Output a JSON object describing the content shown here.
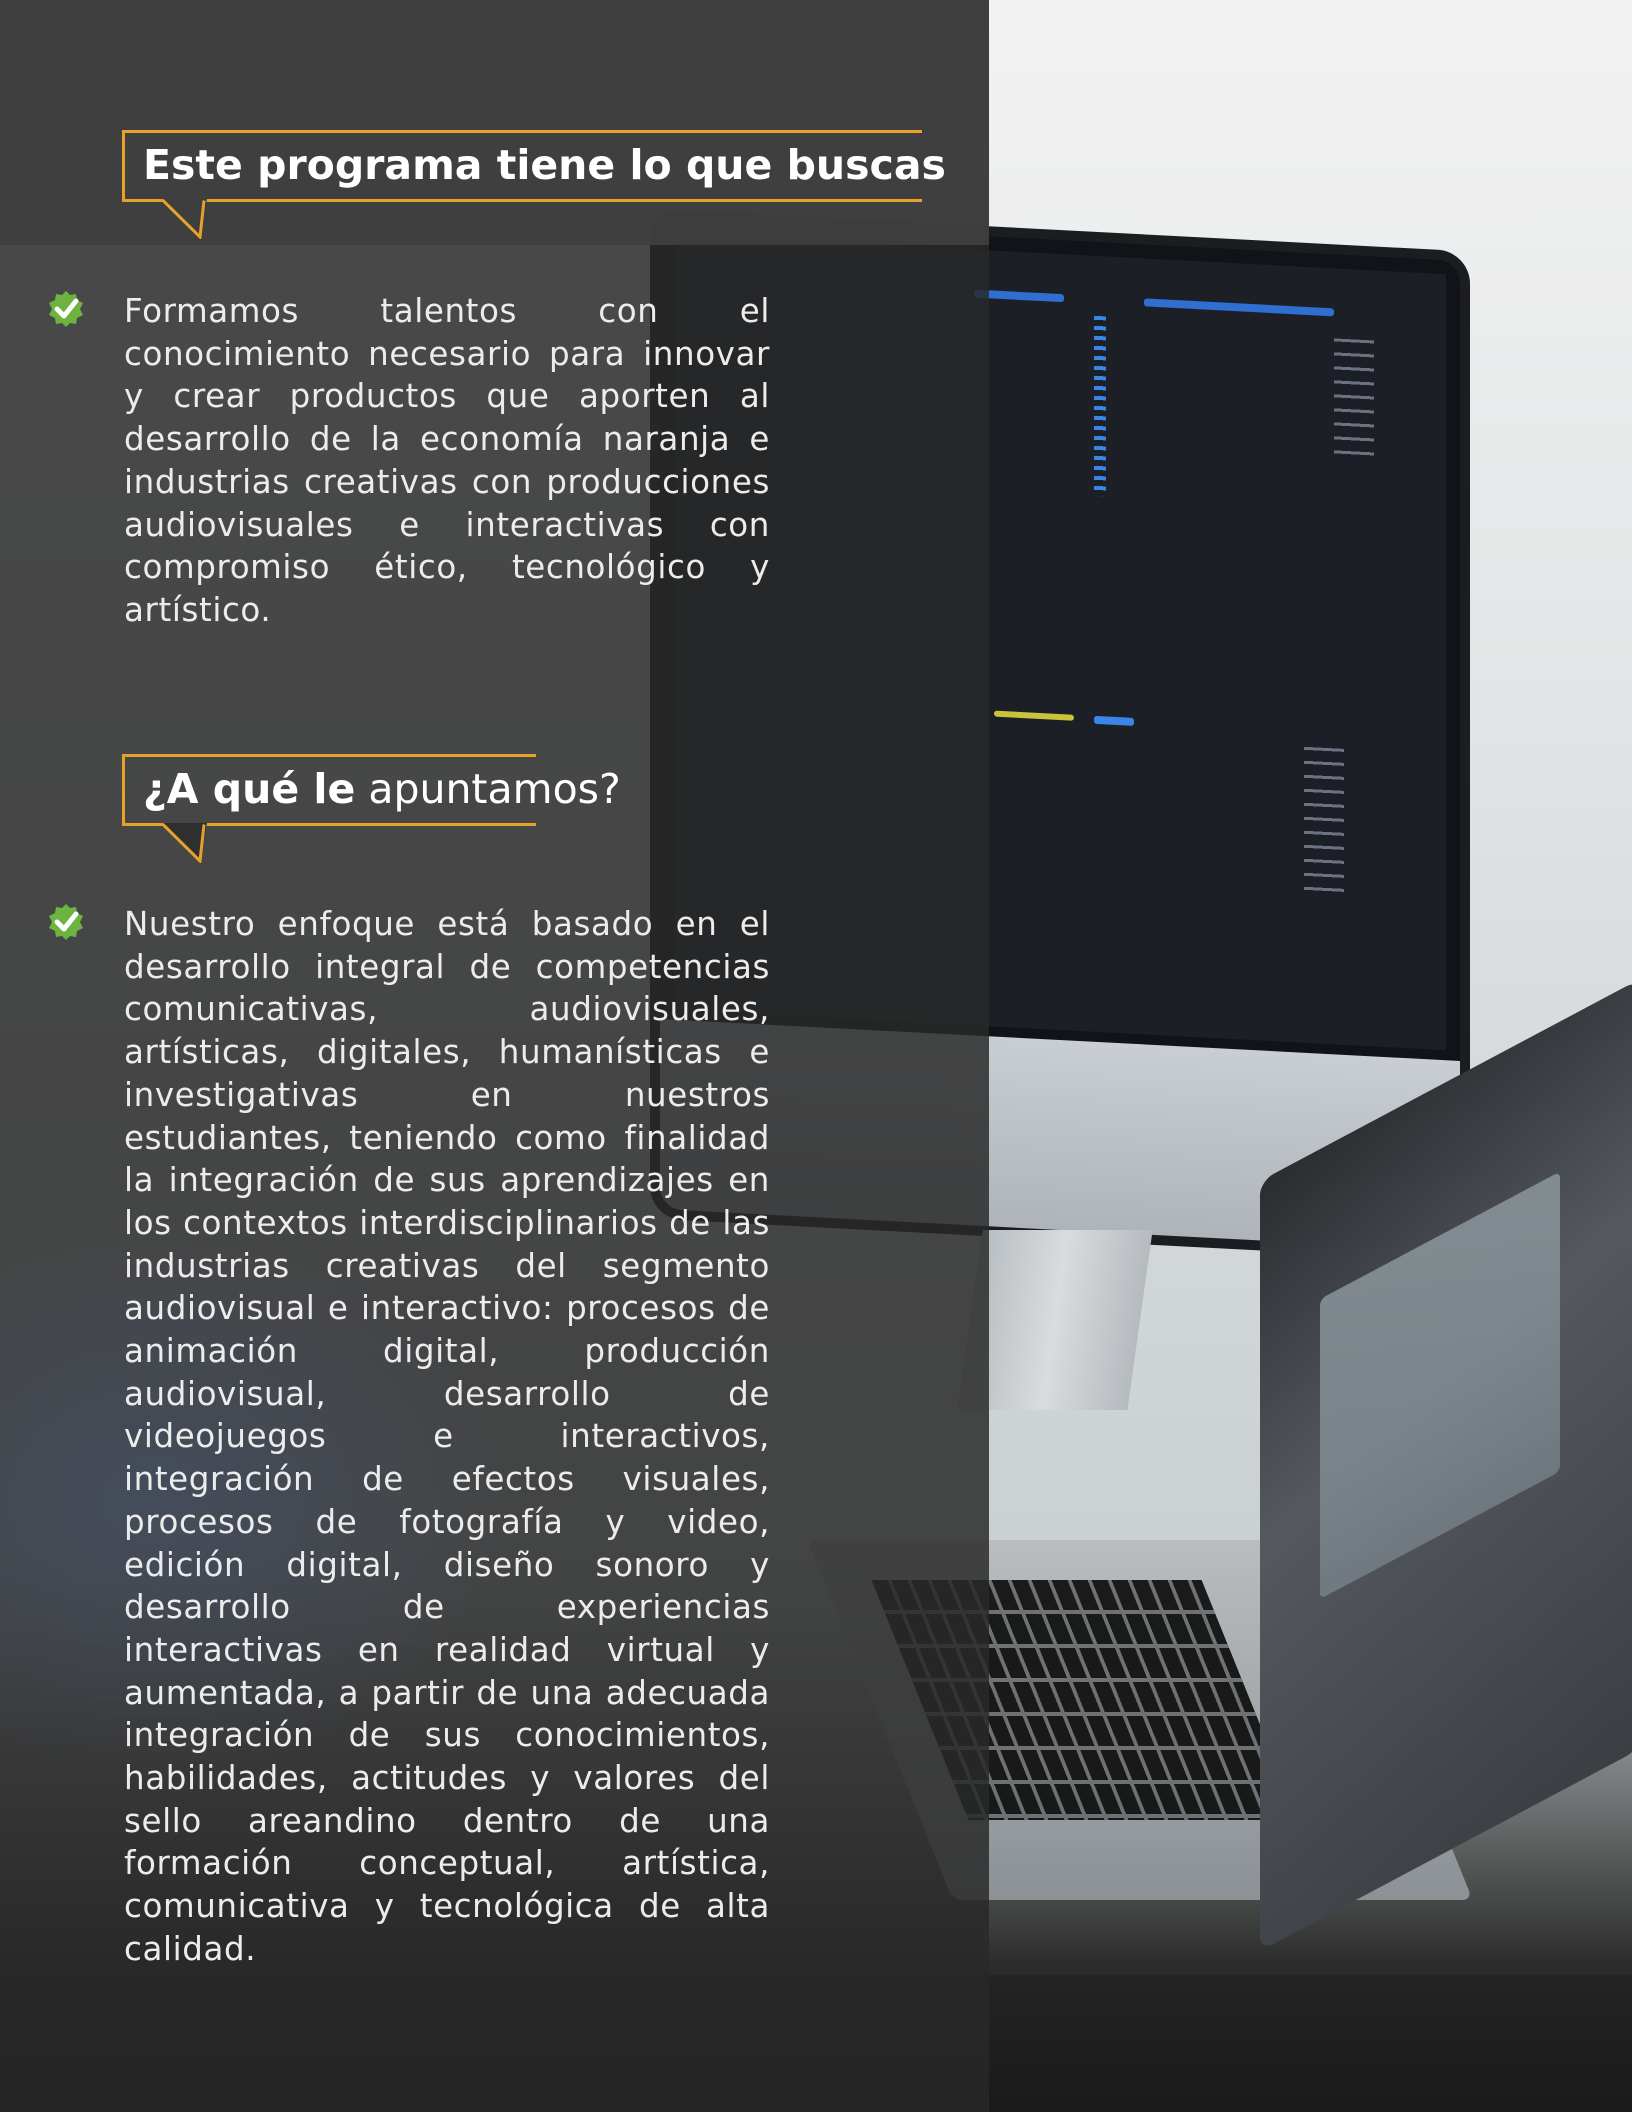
{
  "section1": {
    "title": "Este programa tiene lo que buscas",
    "body": "Formamos talentos con el conocimiento necesario para innovar y crear productos que aporten al desarrollo de la economía naranja e industrias creativas con producciones audiovisuales e interactivas con compromiso ético, tecnológico y artístico."
  },
  "section2": {
    "title_bold": "¿A qué le",
    "title_light": " apuntamos?",
    "body": "Nuestro enfoque está basado en el desarrollo integral de competencias comunicativas, audiovisuales, artísticas, digitales, humanísticas e investigativas en nuestros estudiantes, teniendo como finalidad la integración de sus aprendizajes en los contextos interdisciplinarios de las industrias creativas del segmento audiovisual e interactivo: procesos de animación digital, producción audiovisual, desarrollo de videojuegos e interactivos, integración de efectos visuales, procesos de fotografía y video, edición digital, diseño sonoro y desarrollo de experiencias interactivas en realidad virtual y aumentada, a partir de una adecuada integración de sus conocimientos, habilidades, actitudes y valores del sello areandino dentro de una formación conceptual, artística, comunicativa y tecnológica de alta calidad."
  },
  "colors": {
    "accent": "#e6a22a",
    "check_green": "#6db33f",
    "panel": "#3a3a3a",
    "text": "#ececec"
  },
  "icons": {
    "bullet": "check-badge-icon"
  }
}
